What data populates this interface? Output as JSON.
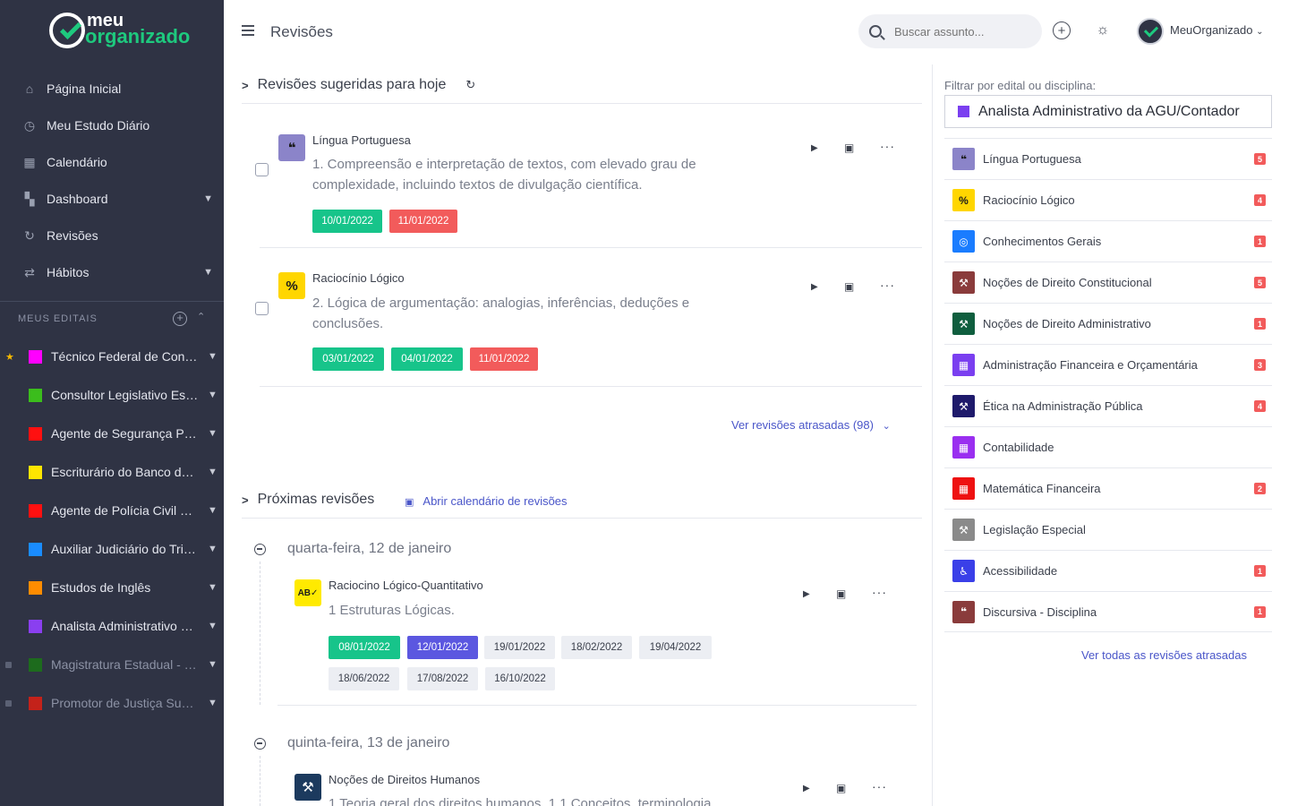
{
  "brand": {
    "line1": "meu",
    "line2": "organizado"
  },
  "sidebar": {
    "nav": [
      {
        "label": "Página Inicial",
        "icon": "home-icon"
      },
      {
        "label": "Meu Estudo Diário",
        "icon": "stopwatch-icon"
      },
      {
        "label": "Calendário",
        "icon": "calendar-icon"
      },
      {
        "label": "Dashboard",
        "icon": "dashboard-icon"
      },
      {
        "label": "Revisões",
        "icon": "refresh-icon"
      },
      {
        "label": "Hábitos",
        "icon": "repeat-icon"
      }
    ],
    "section_label": "MEUS EDITAIS",
    "editais": [
      {
        "label": "Técnico Federal de Contr...",
        "color": "#ff00ff",
        "starred": true
      },
      {
        "label": "Consultor Legislativo Esp...",
        "color": "#3bbd1c"
      },
      {
        "label": "Agente de Segurança Pen...",
        "color": "#ff1010"
      },
      {
        "label": "Escriturário do Banco do ...",
        "color": "#ffe600"
      },
      {
        "label": "Agente de Polícia Civil do ...",
        "color": "#ff1010"
      },
      {
        "label": "Auxiliar Judiciário do Trib...",
        "color": "#1a8cff"
      },
      {
        "label": "Estudos de Inglês",
        "color": "#ff8c00"
      },
      {
        "label": "Analista Administrativo da...",
        "color": "#8a3ff0"
      },
      {
        "label": "Magistratura Estadual - J...",
        "color": "#1d6b1d",
        "faded": true
      },
      {
        "label": "Promotor de Justiça Subs...",
        "color": "#c4221a",
        "faded": true
      }
    ]
  },
  "header": {
    "title": "Revisões",
    "search_placeholder": "Buscar assunto...",
    "user": "MeuOrganizado"
  },
  "today": {
    "title": "Revisões sugeridas para hoje",
    "items": [
      {
        "subject": "Língua Portuguesa",
        "topic_l1": "1. Compreensão e interpretação de textos, com elevado grau de",
        "topic_l2": "complexidade, incluindo textos de divulgação científica.",
        "dates": [
          "10/01/2022",
          "11/01/2022"
        ]
      },
      {
        "subject": "Raciocínio Lógico",
        "topic_l1": "2. Lógica de argumentação: analogias, inferências, deduções e",
        "topic_l2": "conclusões.",
        "dates": [
          "03/01/2022",
          "04/01/2022",
          "11/01/2022"
        ]
      }
    ],
    "late_link": "Ver revisões atrasadas (98)"
  },
  "next": {
    "title": "Próximas revisões",
    "calendar_link": "Abrir calendário de revisões",
    "days": [
      {
        "date": "quarta-feira, 12 de janeiro",
        "subject": "Raciocino Lógico-Quantitativo",
        "topic": "1 Estruturas Lógicas.",
        "dates": [
          "08/01/2022",
          "12/01/2022",
          "19/01/2022",
          "18/02/2022",
          "19/04/2022",
          "18/06/2022",
          "17/08/2022",
          "16/10/2022"
        ]
      },
      {
        "date": "quinta-feira, 13 de janeiro",
        "subject": "Noções de Direitos Humanos",
        "topic": "1 Teoria geral dos direitos humanos. 1.1 Conceitos, terminologia"
      }
    ]
  },
  "filter": {
    "label": "Filtrar por edital ou disciplina:",
    "selected": "Analista Administrativo da AGU/Contador",
    "disciplines": [
      {
        "label": "Língua Portuguesa",
        "color": "#8b84c9",
        "glyph": "“",
        "count": "5"
      },
      {
        "label": "Raciocínio Lógico",
        "color": "#ffd600",
        "glyph": "%",
        "count": "4"
      },
      {
        "label": "Conhecimentos Gerais",
        "color": "#1a7cff",
        "glyph": "◎",
        "count": "1"
      },
      {
        "label": "Noções de Direito Constitucional",
        "color": "#8a3b3b",
        "glyph": "⚒",
        "count": "5"
      },
      {
        "label": "Noções de Direito Administrativo",
        "color": "#0f5e3e",
        "glyph": "⚒",
        "count": "1"
      },
      {
        "label": "Administração Financeira e Orçamentária",
        "color": "#7a3ff0",
        "glyph": "▦",
        "count": "3"
      },
      {
        "label": "Ética na Administração Pública",
        "color": "#1e1a6b",
        "glyph": "⚒",
        "count": "4"
      },
      {
        "label": "Contabilidade",
        "color": "#9a2ff0",
        "glyph": "▦",
        "count": ""
      },
      {
        "label": "Matemática Financeira",
        "color": "#ee1111",
        "glyph": "▦",
        "count": "2"
      },
      {
        "label": "Legislação Especial",
        "color": "#8a8a8a",
        "glyph": "⚒",
        "count": ""
      },
      {
        "label": "Acessibilidade",
        "color": "#3a3fe8",
        "glyph": "♿",
        "count": "1"
      },
      {
        "label": "Discursiva - Disciplina",
        "color": "#8a3b3b",
        "glyph": "“",
        "count": "1"
      }
    ],
    "all_late_link": "Ver todas as revisões atrasadas"
  }
}
